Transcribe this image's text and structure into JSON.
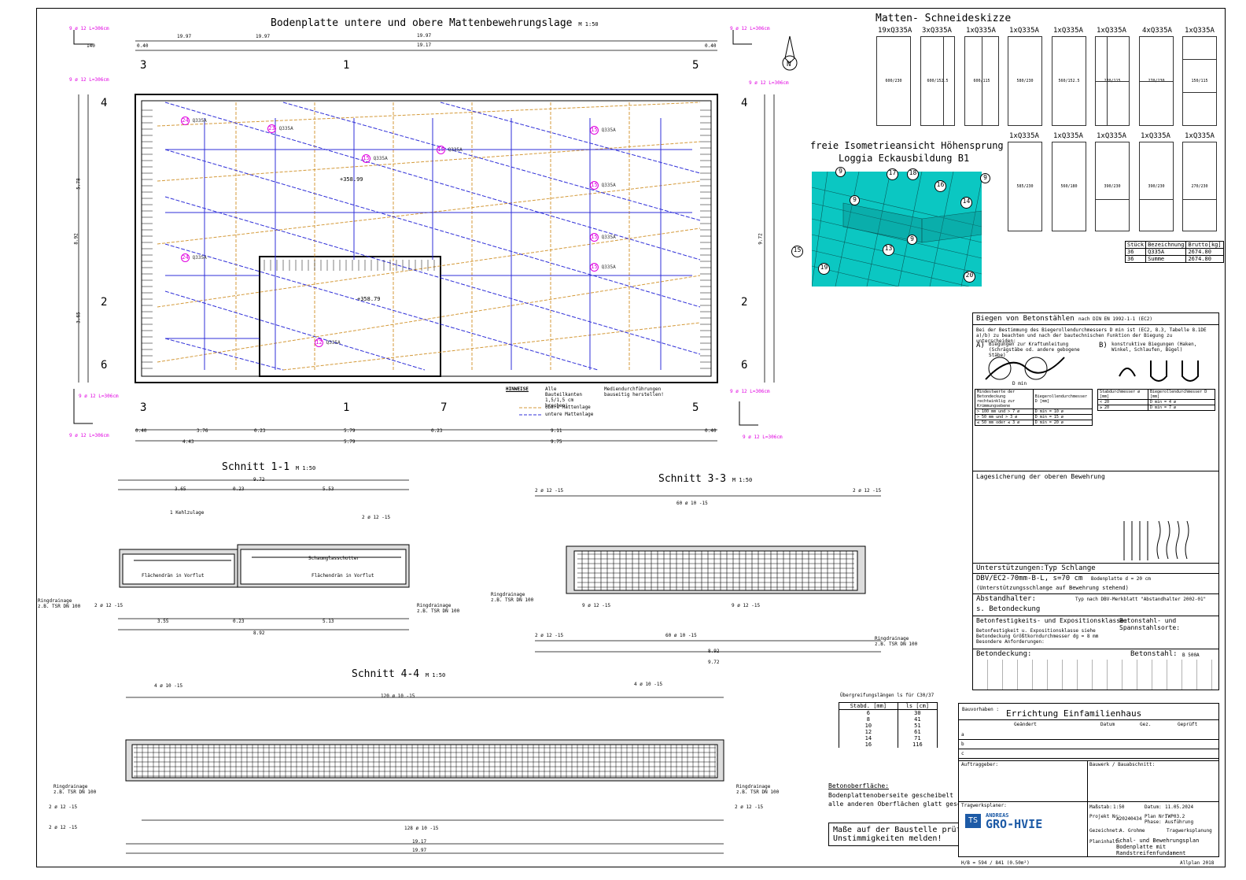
{
  "colors": {
    "upper_mesh": "#d49a3a",
    "lower_mesh": "#2f2fd8",
    "iso_bg": "#0bc7c2",
    "marker": "#e000e0"
  },
  "plan": {
    "title": "Bodenplatte untere und obere Mattenbewehrungslage",
    "scale": "M 1:50",
    "dim_top_outer": "19.97",
    "dim_top_inner": "19.17",
    "dim_040": "0.40",
    "elev_1": "+358.99",
    "elev_2": "+358.79",
    "dim_left": [
      "0.40",
      "5.78",
      "0.23",
      "3.65",
      "0.40"
    ],
    "dim_left_total": "8.92",
    "dim_right_total": "9.72",
    "dim_bottom_1": [
      "0.40",
      "3.76",
      "0.23",
      "5.79",
      "0.23",
      "9.11",
      "0.40"
    ],
    "dim_bottom_2": [
      "4.43",
      "5.79",
      "9.75"
    ],
    "mesh_label": "Q335A",
    "hinweise_title": "HINWEISE",
    "hinweise_1": "Alle Bauteilkanten 1,5/1,5 cm brechen!",
    "hinweise_2": "Mediendurchführungen bauseitig herstellen!",
    "legend_upper": "obere Mattenlage",
    "legend_lower": "untere Mattenlage",
    "corner_label": "9 ø 12 L=306cm",
    "corner_dim": "140"
  },
  "cutting": {
    "title": "Matten- Schneideskizze",
    "headers_row1": [
      "19xQ335A",
      "3xQ335A",
      "1xQ335A",
      "1xQ335A",
      "1xQ335A",
      "1xQ335A",
      "4xQ335A",
      "1xQ335A"
    ],
    "headers_row2": [
      "1xQ335A",
      "1xQ335A",
      "1xQ335A",
      "1xQ335A",
      "1xQ335A"
    ],
    "cells_row1": [
      "600/230",
      "600/152.5",
      "600/115",
      "580/230",
      "560/152.5",
      "270/115",
      "270/230",
      "150/115"
    ],
    "cells_row2": [
      "585/230",
      "560/180",
      "390/230",
      "390/230",
      "270/230"
    ],
    "table_headers": [
      "Stück",
      "Bezeichnung",
      "Brutto[kg]"
    ],
    "table_rows": [
      [
        "36",
        "Q335A",
        "2674.80"
      ],
      [
        "36",
        "Summe",
        "2674.80"
      ]
    ]
  },
  "iso": {
    "title_1": "freie Isometrieansicht Höhensprung",
    "title_2": "Loggia Eckausbildung B1",
    "markers": [
      "9",
      "17",
      "18",
      "16",
      "9",
      "9",
      "14",
      "15",
      "13",
      "9",
      "19",
      "20"
    ]
  },
  "bending": {
    "title": "Biegen von Betonstählen",
    "norm": "nach DIN EN 1992-1-1 (EC2)",
    "intro": "Bei der Bestimmung des Biegerollendurchmessers D min ist (EC2, 8.3, Tabelle 8.1DE a)/b) zu beachten und nach der bautechnischen Funktion der Biegung zu unterscheiden:",
    "a_label": "A)",
    "a_text": "Biegungen zur Kraftumleitung (Schrägstäbe od. andere gebogene Stäbe)",
    "b_label": "B)",
    "b_text": "konstruktive Biegungen (Haken, Winkel, Schlaufen, Bügel)",
    "dmin": "D min",
    "table_a_head": [
      "Mindestwerte der Betondeckung rechtwinklig zur Krümmungsebene",
      "Biegerollendurchmesser D [mm]"
    ],
    "table_a_rows": [
      [
        "> 100 mm und > 7 ø",
        "D min = 10 ø"
      ],
      [
        "> 50 mm und > 3 ø",
        "D min = 15 ø"
      ],
      [
        "≤ 50 mm oder ≤ 3 ø",
        "D min = 20 ø"
      ]
    ],
    "table_b_head": [
      "Stabdurchmesser ø [mm]",
      "Biegerollendurchmesser D [mm]"
    ],
    "table_b_rows": [
      [
        "< 20",
        "D min = 4 ø"
      ],
      [
        "≥ 20",
        "D min = 7 ø"
      ]
    ],
    "lagesicherung": "Lagesicherung der oberen Bewehrung",
    "unterstuetzung": "Unterstützungen:Typ Schlange",
    "typ": "DBV/EC2-70mm-B-L, s=70 cm",
    "bodenplatte": "Bodenplatte d = 20 cm",
    "unterstuetzung_note": "(Unterstützungsschlange auf Bewehrung stehend)",
    "abstandhalter": "Abstandhalter:",
    "abstandhalter_typ": "Typ nach DBV-Merkblatt \"Abstandhalter 2002-01\"",
    "betondeckung_s": "s. Betondeckung",
    "klasse": "Betonfestigkeits- und Expositionsklasse:",
    "betonstahl_sorte": "Betonstahl- und Spannstahlsorte:",
    "klasse_text": "Betonfestigkeit u. Expositionsklasse siehe Betondeckung Größtkorndurchmesser dg = 8 mm Besondere Anforderungen:",
    "betondeckung": "Betondeckung:",
    "betonstahl": "Betonstahl:",
    "betonstahl_val": "B 500A"
  },
  "sections": {
    "s11_title": "Schnitt 1-1",
    "s33_title": "Schnitt 3-3",
    "s44_title": "Schnitt 4-4",
    "scale": "M 1:50",
    "s11_dims_top": [
      "3.65",
      "0.23",
      "5.53"
    ],
    "s11_total": "9.72",
    "s11_dims_bottom": [
      "3.55",
      "0.23",
      "5.13"
    ],
    "s11_total_bottom": "8.92",
    "s33_top": "8.92",
    "s33_total": "9.72",
    "s44_top": "19.17",
    "s44_total": "19.97",
    "labels": [
      "Kehlzulage",
      "Flächendrän in Vorflut",
      "Schaumglasschotter",
      "Ringdrainage z.B. TSR DN 100"
    ],
    "bar_labels": [
      "2 ø 12 -15",
      "9 ø 12 -15",
      "60 ø 10 -15",
      "120 ø 10 -15",
      "128 ø 10 -15",
      "4 ø 10 -15"
    ]
  },
  "overlap": {
    "title": "Übergreifungslängen ls für C30/37",
    "head": [
      "Stabd. [mm]",
      "ls [cm]"
    ],
    "rows": [
      [
        "6",
        "30"
      ],
      [
        "8",
        "41"
      ],
      [
        "10",
        "51"
      ],
      [
        "12",
        "61"
      ],
      [
        "14",
        "71"
      ],
      [
        "16",
        "116"
      ]
    ]
  },
  "surface": {
    "title": "Betonoberfläche:",
    "line1": "Bodenplattenoberseite gescheibelt",
    "line2": "alle anderen Oberflächen glatt geschalt"
  },
  "warning": {
    "line1": "Maße auf der Baustelle prüfen!",
    "line2": "Unstimmigkeiten melden!"
  },
  "titleblock": {
    "bauvorhaben_label": "Bauvorhaben :",
    "bauvorhaben": "Errichtung Einfamilienhaus",
    "cols": [
      "Geändert",
      "Datum",
      "Gez.",
      "Geprüft"
    ],
    "rows": [
      "a",
      "b",
      "c"
    ],
    "auftraggeber": "Auftraggeber:",
    "bauwerk": "Bauwerk / Bauabschnitt:",
    "tragwerksplaner": "Tragwerksplaner:",
    "company_1": "ANDREAS",
    "company_2": "GRO-HVIE",
    "massstab_label": "Maßstab:",
    "massstab": "1:50",
    "datum_label": "Datum:",
    "datum": "11.05.2024",
    "projekt_label": "Projekt Nr:",
    "projekt": "A20240434",
    "plan_label": "Plan Nr:",
    "plan": "TWP03.2",
    "phase_label": "Phase:",
    "phase": "Ausführung",
    "gez_label": "Gezeichnet:",
    "gez": "A. Grohme",
    "tragwerk": "Tragwerksplanung",
    "planinhalt_label": "Planinhalt:",
    "planinhalt": "Schal- und Bewehrungsplan Bodenplatte mit Randstreifenfundament"
  },
  "footer": {
    "size": "H/B = 594 / 841 (0.50m²)",
    "software": "Allplan 2018"
  }
}
